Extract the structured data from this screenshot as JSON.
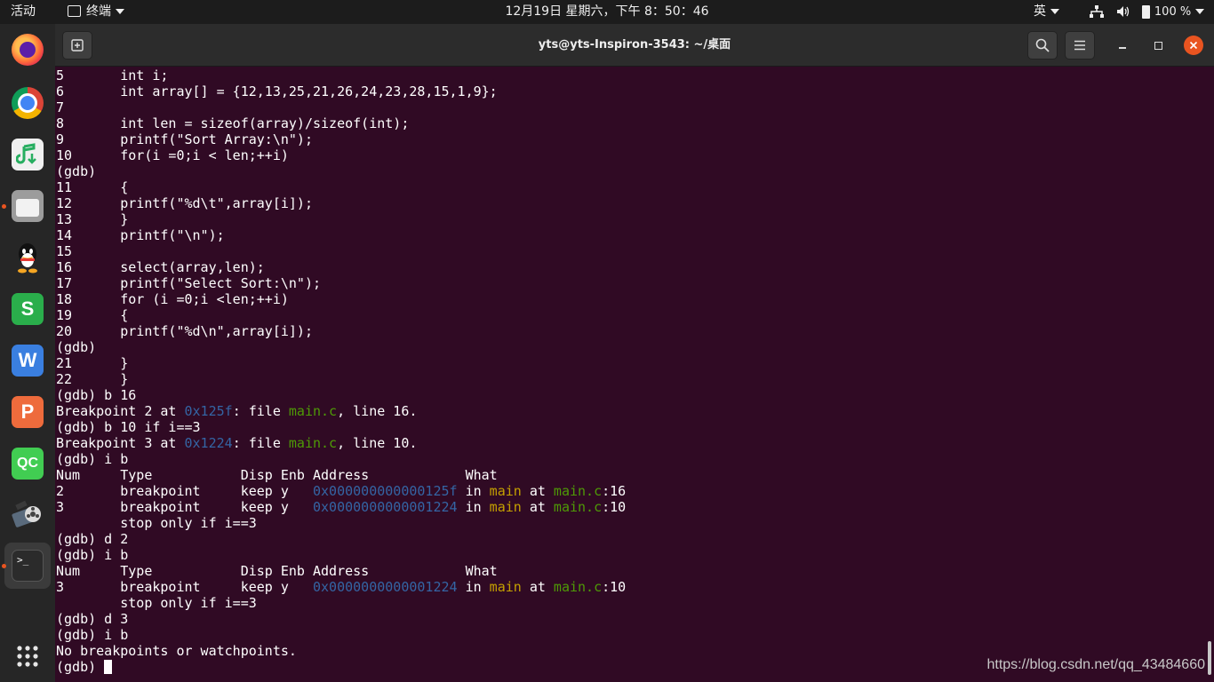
{
  "topbar": {
    "activities": "活动",
    "app_menu": "终端",
    "clock": "12月19日 星期六，下午 8：50：46",
    "input_method": "英",
    "battery": "100 %"
  },
  "dock": {
    "apps": [
      "firefox",
      "chrome",
      "music-downloader",
      "files",
      "qq",
      "wps-spreadsheets",
      "wps-writer",
      "wps-presentation",
      "qt-creator",
      "video-editor",
      "terminal"
    ],
    "wps_s": "S",
    "wps_w": "W",
    "wps_p": "P",
    "qt": "QC",
    "terminal_glyph": ">_"
  },
  "window": {
    "title": "yts@yts-Inspiron-3543: ~/桌面"
  },
  "terminal": {
    "lines": [
      [
        {
          "t": "5       int i;"
        }
      ],
      [
        {
          "t": "6       int array[] = {12,13,25,21,26,24,23,28,15,1,9};"
        }
      ],
      [
        {
          "t": "7"
        }
      ],
      [
        {
          "t": "8       int len = sizeof(array)/sizeof(int);"
        }
      ],
      [
        {
          "t": "9       printf(\"Sort Array:\\n\");"
        }
      ],
      [
        {
          "t": "10      for(i =0;i < len;++i)"
        }
      ],
      [
        {
          "t": "(gdb)"
        }
      ],
      [
        {
          "t": "11      {"
        }
      ],
      [
        {
          "t": "12      printf(\"%d\\t\",array[i]);"
        }
      ],
      [
        {
          "t": "13      }"
        }
      ],
      [
        {
          "t": "14      printf(\"\\n\");"
        }
      ],
      [
        {
          "t": "15"
        }
      ],
      [
        {
          "t": "16      select(array,len);"
        }
      ],
      [
        {
          "t": "17      printf(\"Select Sort:\\n\");"
        }
      ],
      [
        {
          "t": "18      for (i =0;i <len;++i)"
        }
      ],
      [
        {
          "t": "19      {"
        }
      ],
      [
        {
          "t": "20      printf(\"%d\\n\",array[i]);"
        }
      ],
      [
        {
          "t": "(gdb)"
        }
      ],
      [
        {
          "t": "21      }"
        }
      ],
      [
        {
          "t": "22      }"
        }
      ],
      [
        {
          "t": "(gdb) b 16"
        }
      ],
      [
        {
          "t": "Breakpoint 2 at "
        },
        {
          "t": "0x125f",
          "c": "addr"
        },
        {
          "t": ": file "
        },
        {
          "t": "main.c",
          "c": "file"
        },
        {
          "t": ", line 16."
        }
      ],
      [
        {
          "t": "(gdb) b 10 if i==3"
        }
      ],
      [
        {
          "t": "Breakpoint 3 at "
        },
        {
          "t": "0x1224",
          "c": "addr"
        },
        {
          "t": ": file "
        },
        {
          "t": "main.c",
          "c": "file"
        },
        {
          "t": ", line 10."
        }
      ],
      [
        {
          "t": "(gdb) i b"
        }
      ],
      [
        {
          "t": "Num     Type           Disp Enb Address            What"
        }
      ],
      [
        {
          "t": "2       breakpoint     keep y   "
        },
        {
          "t": "0x000000000000125f",
          "c": "addr"
        },
        {
          "t": " in "
        },
        {
          "t": "main",
          "c": "func"
        },
        {
          "t": " at "
        },
        {
          "t": "main.c",
          "c": "file"
        },
        {
          "t": ":16"
        }
      ],
      [
        {
          "t": "3       breakpoint     keep y   "
        },
        {
          "t": "0x0000000000001224",
          "c": "addr"
        },
        {
          "t": " in "
        },
        {
          "t": "main",
          "c": "func"
        },
        {
          "t": " at "
        },
        {
          "t": "main.c",
          "c": "file"
        },
        {
          "t": ":10"
        }
      ],
      [
        {
          "t": "        stop only if i==3"
        }
      ],
      [
        {
          "t": "(gdb) d 2"
        }
      ],
      [
        {
          "t": "(gdb) i b"
        }
      ],
      [
        {
          "t": "Num     Type           Disp Enb Address            What"
        }
      ],
      [
        {
          "t": "3       breakpoint     keep y   "
        },
        {
          "t": "0x0000000000001224",
          "c": "addr"
        },
        {
          "t": " in "
        },
        {
          "t": "main",
          "c": "func"
        },
        {
          "t": " at "
        },
        {
          "t": "main.c",
          "c": "file"
        },
        {
          "t": ":10"
        }
      ],
      [
        {
          "t": "        stop only if i==3"
        }
      ],
      [
        {
          "t": "(gdb) d 3"
        }
      ],
      [
        {
          "t": "(gdb) i b"
        }
      ],
      [
        {
          "t": "No breakpoints or watchpoints."
        }
      ],
      [
        {
          "t": "(gdb) "
        }
      ]
    ]
  },
  "watermark": "https://blog.csdn.net/qq_43484660",
  "colors": {
    "terminal_bg": "#300a24",
    "address": "#3465a4",
    "filename": "#4e9a06",
    "function": "#c4a000",
    "accent": "#e95420"
  }
}
